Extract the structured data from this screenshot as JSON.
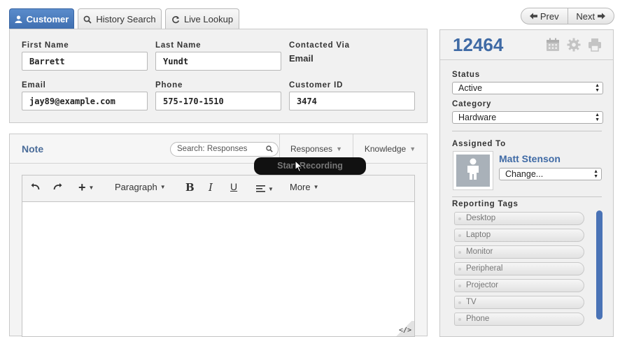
{
  "tabs": [
    {
      "label": "Customer",
      "icon": "user-icon",
      "active": true
    },
    {
      "label": "History Search",
      "icon": "search-icon",
      "active": false
    },
    {
      "label": "Live Lookup",
      "icon": "refresh-icon",
      "active": false
    }
  ],
  "customer": {
    "first_name_label": "First Name",
    "first_name_value": "Barrett",
    "last_name_label": "Last Name",
    "last_name_value": "Yundt",
    "contacted_via_label": "Contacted Via",
    "contacted_via_value": "Email",
    "email_label": "Email",
    "email_value": "jay89@example.com",
    "phone_label": "Phone",
    "phone_value": "575-170-1510",
    "customer_id_label": "Customer ID",
    "customer_id_value": "3474"
  },
  "note": {
    "title": "Note",
    "search_placeholder": "Search: Responses",
    "responses_label": "Responses",
    "knowledge_label": "Knowledge",
    "toolbar": {
      "paragraph_label": "Paragraph",
      "more_label": "More",
      "code_label": "</>"
    },
    "tooltip": "Start Recording"
  },
  "nav": {
    "prev_label": "Prev",
    "next_label": "Next"
  },
  "sidebar": {
    "ticket_id": "12464",
    "status_label": "Status",
    "status_value": "Active",
    "category_label": "Category",
    "category_value": "Hardware",
    "assigned_label": "Assigned To",
    "assignee_name": "Matt Stenson",
    "change_value": "Change...",
    "reporting_tags_label": "Reporting Tags",
    "tags": [
      "Desktop",
      "Laptop",
      "Monitor",
      "Peripheral",
      "Projector",
      "TV",
      "Phone"
    ]
  },
  "colors": {
    "accent": "#3f6aa5",
    "active_tab": "#4a7cbf",
    "scrollbar": "#4a73b6"
  }
}
